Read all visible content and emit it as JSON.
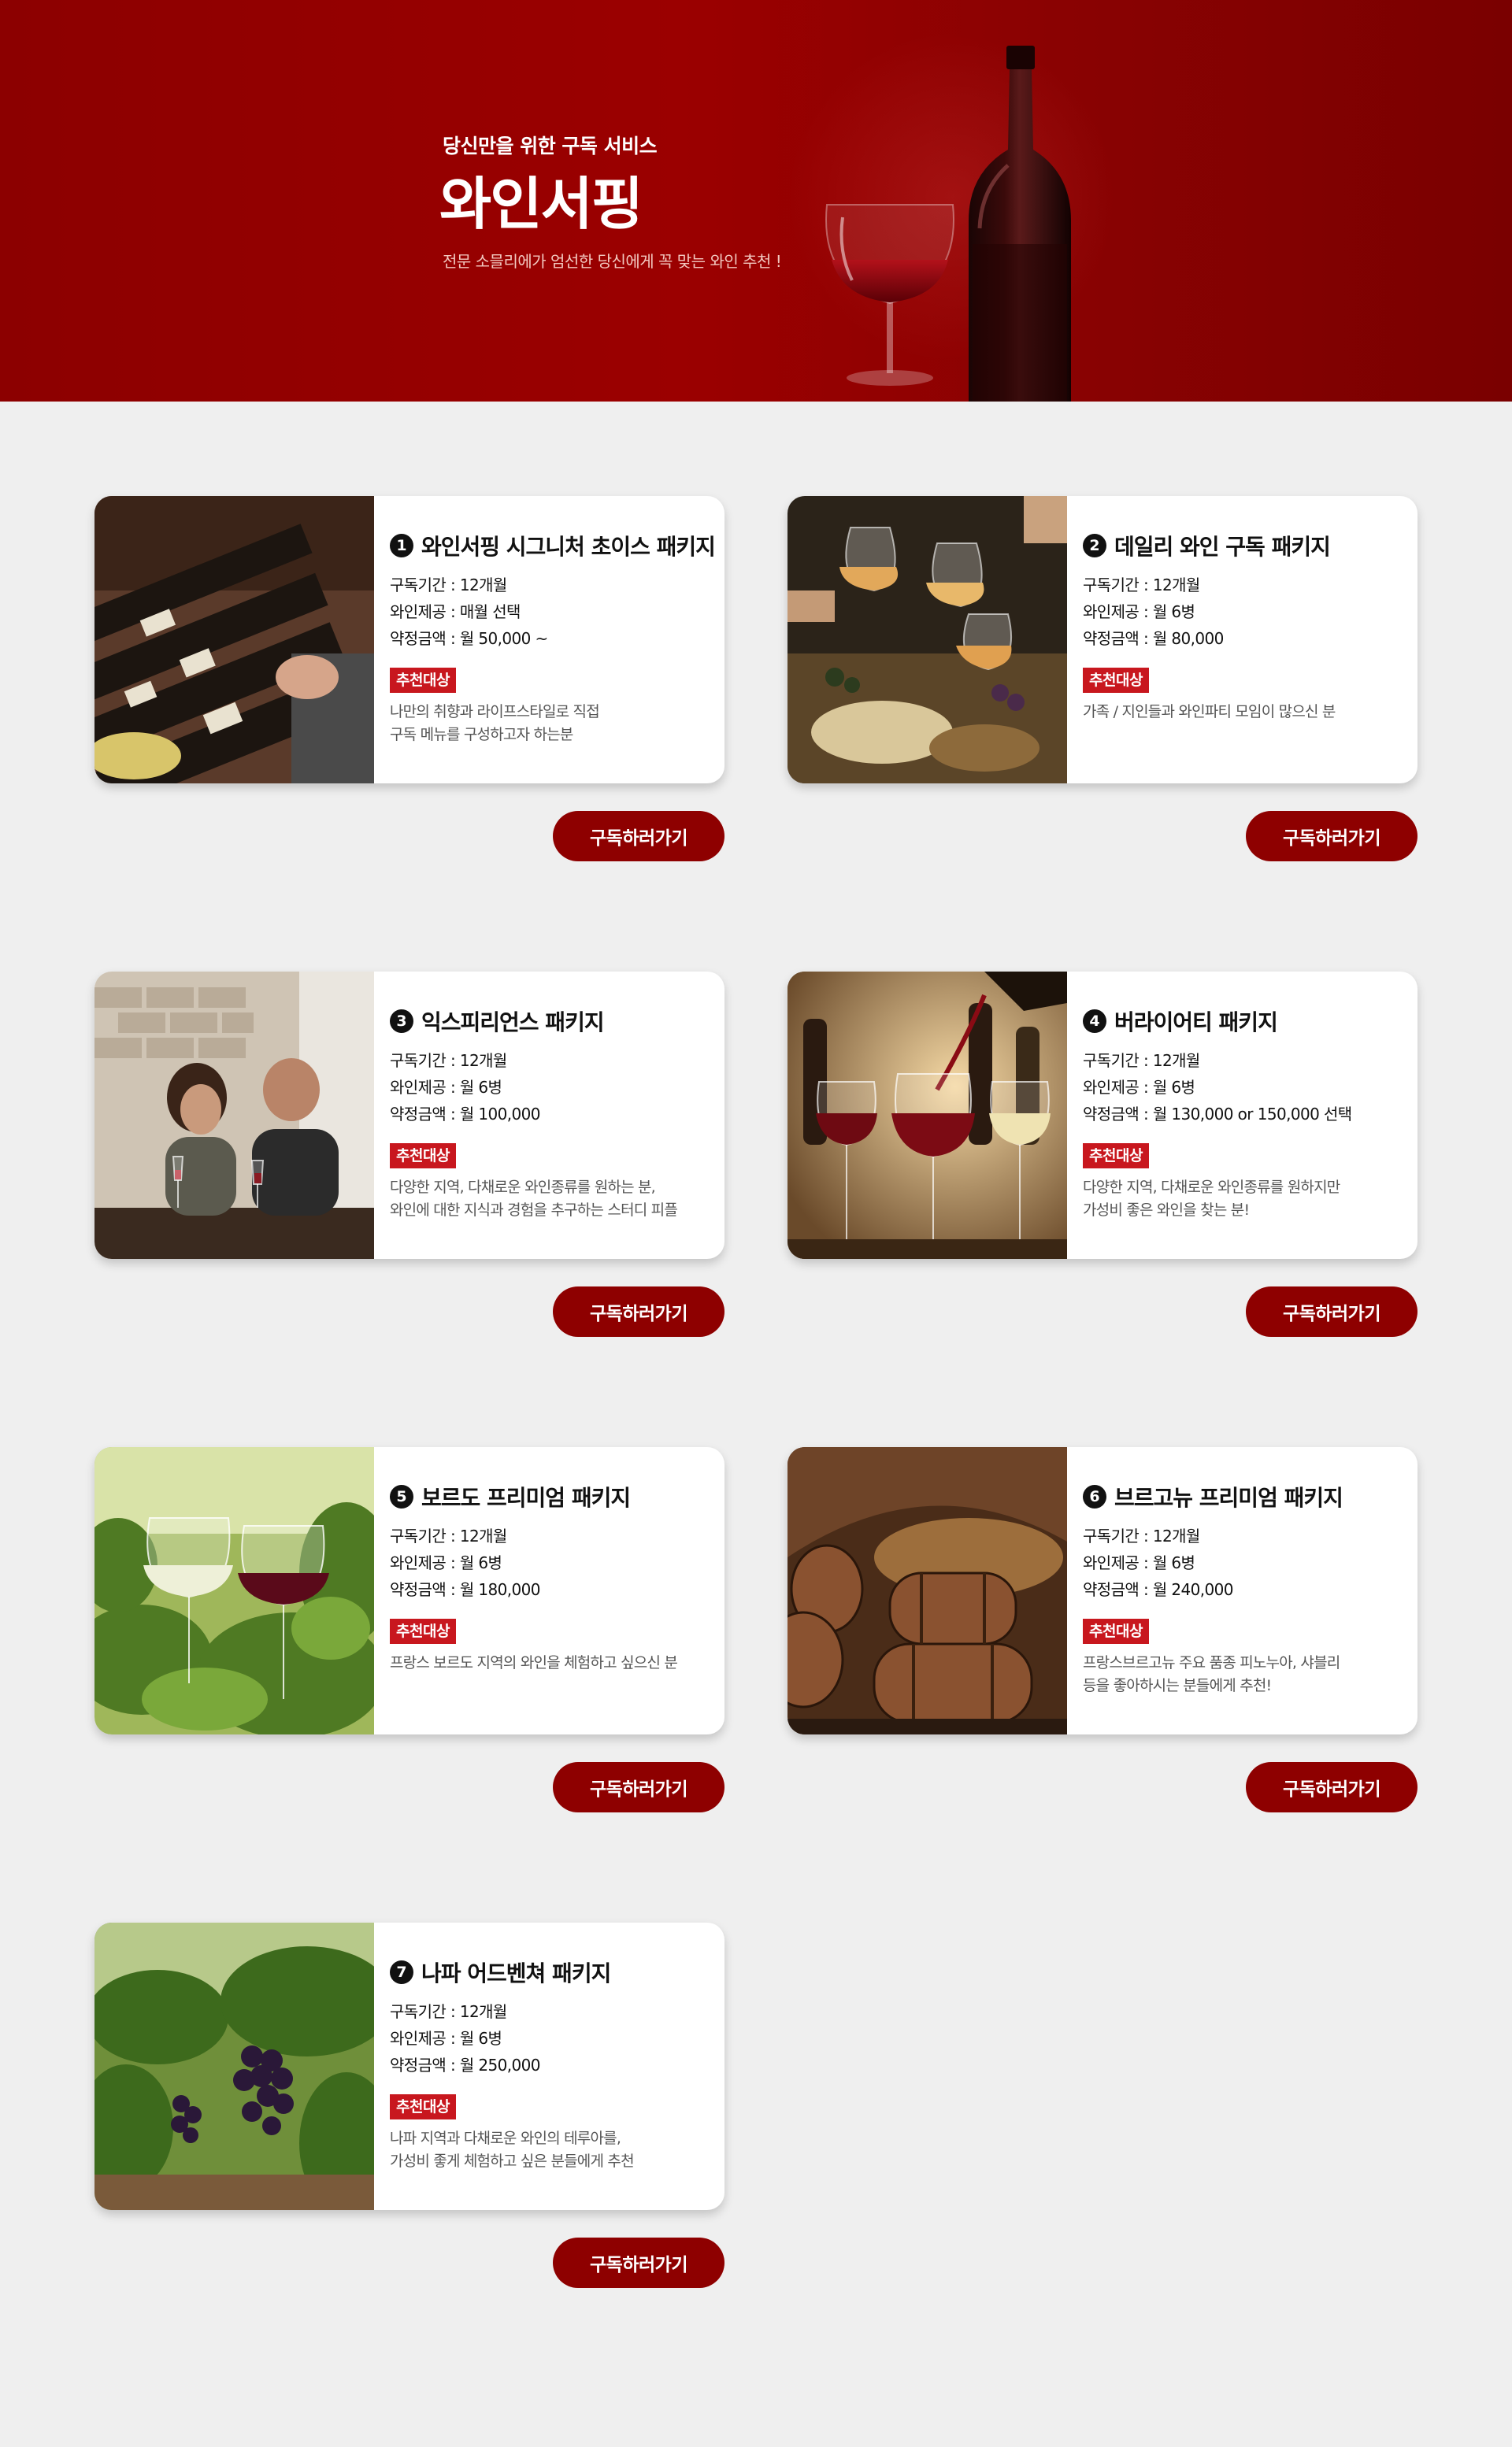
{
  "hero": {
    "subtitle": "당신만을 위한 구독 서비스",
    "title": "와인서핑",
    "description": "전문 소믈리에가 엄선한 당신에게 꼭 맞는 와인 추천 !"
  },
  "colors": {
    "hero_bg": "#9b0000",
    "button": "#8e0000",
    "badge": "#c8171e",
    "page_bg": "#efefef"
  },
  "packages": [
    {
      "num": "1",
      "title": "와인서핑 시그니처 초이스 패키지",
      "period": "구독기간 : 12개월",
      "supply": "와인제공 : 매월 선택",
      "price": "약정금액 : 월 50,000 ~",
      "badge": "추천대상",
      "desc1": "나만의 취향과 라이프스타일로 직접",
      "desc2": "구독 메뉴를 구성하고자 하는분",
      "button": "구독하러가기",
      "image": "wine-bottle-shelf-image"
    },
    {
      "num": "2",
      "title": "데일리 와인 구독 패키지",
      "period": "구독기간 : 12개월",
      "supply": "와인제공 : 월 6병",
      "price": "약정금액 : 월 80,000",
      "badge": "추천대상",
      "desc1": "가족 / 지인들과 와인파티 모임이 많으신 분",
      "desc2": "",
      "button": "구독하러가기",
      "image": "wine-toast-party-image"
    },
    {
      "num": "3",
      "title": "익스피리언스 패키지",
      "period": "구독기간 : 12개월",
      "supply": "와인제공 : 월 6병",
      "price": "약정금액 : 월 100,000",
      "badge": "추천대상",
      "desc1": "다양한 지역, 다채로운 와인종류를 원하는 분,",
      "desc2": "와인에 대한 지식과 경험을 추구하는 스터디 피플",
      "button": "구독하러가기",
      "image": "wine-tasting-couple-image"
    },
    {
      "num": "4",
      "title": "버라이어티 패키지",
      "period": "구독기간 : 12개월",
      "supply": "와인제공 : 월 6병",
      "price": "약정금액 : 월 130,000 or 150,000 선택",
      "badge": "추천대상",
      "desc1": "다양한 지역, 다채로운 와인종류를 원하지만",
      "desc2": "가성비 좋은 와인을 찾는 분!",
      "button": "구독하러가기",
      "image": "wine-pouring-glasses-image"
    },
    {
      "num": "5",
      "title": "보르도 프리미엄 패키지",
      "period": "구독기간 : 12개월",
      "supply": "와인제공 : 월 6병",
      "price": "약정금액 : 월 180,000",
      "badge": "추천대상",
      "desc1": "프랑스 보르도 지역의 와인을 체험하고 싶으신 분",
      "desc2": "",
      "button": "구독하러가기",
      "image": "vineyard-glasses-image"
    },
    {
      "num": "6",
      "title": "브르고뉴 프리미엄 패키지",
      "period": "구독기간 : 12개월",
      "supply": "와인제공 : 월 6병",
      "price": "약정금액 : 월 240,000",
      "badge": "추천대상",
      "desc1": "프랑스브르고뉴 주요 품종 피노누아, 샤블리",
      "desc2": "등을 좋아하시는 분들에게 추천!",
      "button": "구독하러가기",
      "image": "wine-cellar-barrels-image"
    },
    {
      "num": "7",
      "title": "나파 어드벤쳐 패키지",
      "period": "구독기간 : 12개월",
      "supply": "와인제공 : 월 6병",
      "price": "약정금액 : 월 250,000",
      "badge": "추천대상",
      "desc1": "나파 지역과 다채로운 와인의 테루아를,",
      "desc2": "가성비 좋게 체험하고 싶은 분들에게 추천",
      "button": "구독하러가기",
      "image": "grape-vineyard-image"
    }
  ]
}
